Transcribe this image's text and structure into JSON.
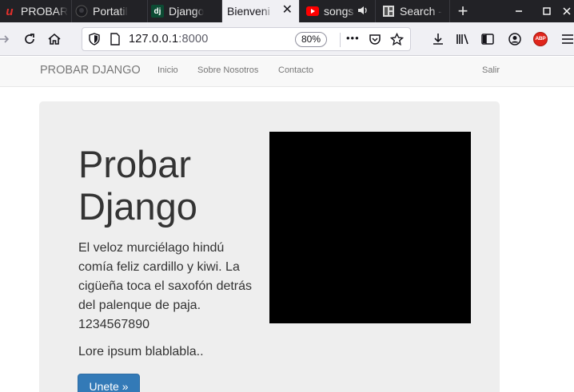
{
  "browser": {
    "tabs": [
      {
        "label": "PROBAR",
        "icon": "u-brand-icon",
        "active": false
      },
      {
        "label": "Portatil",
        "icon": "github-icon",
        "active": false
      },
      {
        "label": "Django",
        "icon": "django-icon",
        "active": false
      },
      {
        "label": "Bienveni",
        "icon": "",
        "active": true
      },
      {
        "label": "songs",
        "icon": "youtube-icon",
        "active": false
      },
      {
        "label": "Search -",
        "icon": "grid-icon",
        "active": false
      }
    ],
    "active_tab_close": "✕",
    "new_tab": "+",
    "url": {
      "host": "127.0.0.1",
      "port": ":8000"
    },
    "zoom": "80%",
    "more": "•••",
    "adblock_badge": "ABP",
    "icon_colors": {
      "u_brand": "#e2302c",
      "django": "#0c4b33",
      "youtube": "#ff0000",
      "adblock": "#e0251b"
    }
  },
  "site": {
    "brand": "PROBAR DJANGO",
    "nav": [
      "Inicio",
      "Sobre Nosotros",
      "Contacto"
    ],
    "logout": "Salir"
  },
  "jumbotron": {
    "title_line1": "Probar",
    "title_line2": "Django",
    "text_lines": [
      "El veloz murciélago hindú",
      "comía feliz cardillo y kiwi. La",
      "cigüeña toca el saxofón detrás",
      "del palenque de paja.",
      "1234567890"
    ],
    "lore": "Lore ipsum blablabla..",
    "button": "Unete »",
    "button_color": "#337ab7"
  }
}
